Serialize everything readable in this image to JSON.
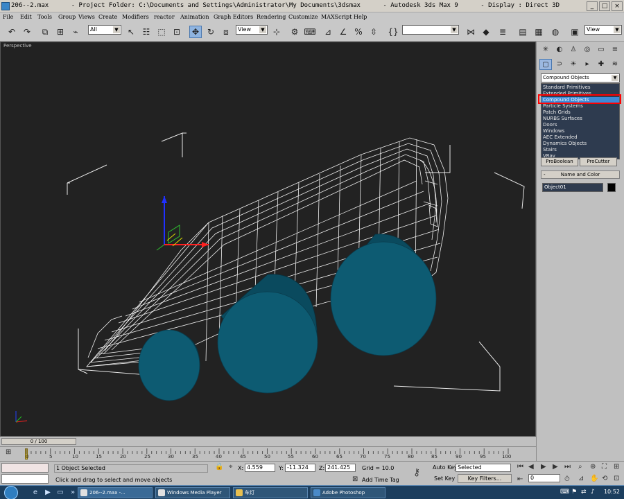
{
  "window": {
    "title": "206--2.max      - Project Folder: C:\\Documents and Settings\\Administrator\\My Documents\\3dsmax      - Autodesk 3ds Max 9      - Display : Direct 3D",
    "buttons": [
      "_",
      "□",
      "×"
    ]
  },
  "menu": [
    "File",
    "Edit",
    "Tools",
    "Group",
    "Views",
    "Create",
    "Modifiers",
    "reactor",
    "Animation",
    "Graph Editors",
    "Rendering",
    "Customize",
    "MAXScript",
    "Help"
  ],
  "toolbar": {
    "selection_filter": "All",
    "ref_coord": "View",
    "named_selection": "",
    "render_view": "View"
  },
  "viewport": {
    "label": "Perspective"
  },
  "command_panel": {
    "category_selected": "Compound Objects",
    "category_options": [
      "Standard Primitives",
      "Extended Primitives",
      "Compound Objects",
      "Particle Systems",
      "Patch Grids",
      "NURBS Surfaces",
      "Doors",
      "Windows",
      "AEC Extended",
      "Dynamics Objects",
      "Stairs",
      "VRay"
    ],
    "highlighted_option": "Compound Objects",
    "buttons": [
      "ProBoolean",
      "ProCutter"
    ],
    "rollout_title": "Name and Color",
    "object_name": "Object01",
    "object_color": "#000000"
  },
  "timeline": {
    "frame_label": "0 / 100",
    "ticks": [
      "0",
      "5",
      "10",
      "15",
      "20",
      "25",
      "30",
      "35",
      "40",
      "45",
      "50",
      "55",
      "60",
      "65",
      "70",
      "75",
      "80",
      "85",
      "90",
      "95",
      "100"
    ]
  },
  "status": {
    "selection": "1 Object Selected",
    "prompt": "Click and drag to select and move objects",
    "x_label": "X:",
    "x": "4.559",
    "y_label": "Y:",
    "y": "-11.324",
    "z_label": "Z:",
    "z": "241.425",
    "grid": "Grid = 10.0",
    "add_time_tag": "Add Time Tag",
    "auto_key": "Auto Key",
    "set_key": "Set Key",
    "key_mode": "Selected",
    "key_filters": "Key Filters...",
    "current_frame": "0"
  },
  "taskbar": {
    "tasks": [
      "206--2.max       -...",
      "Windows Media Player",
      "车灯",
      "Adobe Photoshop"
    ],
    "clock": "10:52"
  }
}
